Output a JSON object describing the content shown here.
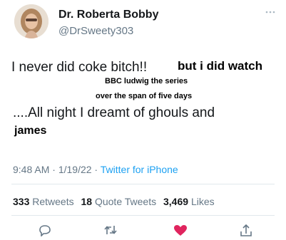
{
  "tweet": {
    "display_name": "Dr. Roberta Bobby",
    "handle": "@DrSweety303",
    "line1": "I never did coke bitch!!",
    "line2": "....All night I dreamt of ghouls and",
    "overlay": {
      "text1": "but i did watch",
      "text2": "BBC ludwig the series",
      "text3": "over the span of five days",
      "text4": "james"
    },
    "time": "9:48 AM",
    "sep1": " · ",
    "date": "1/19/22",
    "sep2": " · ",
    "source": "Twitter for iPhone"
  },
  "stats": {
    "retweets_count": "333",
    "retweets_label": "Retweets",
    "quotes_count": "18",
    "quotes_label": "Quote Tweets",
    "likes_count": "3,469",
    "likes_label": "Likes"
  },
  "colors": {
    "text": "#14171a",
    "secondary": "#657786",
    "link": "#1da1f2",
    "like": "#e0245e",
    "divider": "#e1e8ed"
  },
  "icons": {
    "avatar": "profile-photo",
    "more": "more-dots-icon",
    "reply": "reply-icon",
    "retweet": "retweet-icon",
    "like": "heart-icon",
    "share": "share-icon"
  }
}
